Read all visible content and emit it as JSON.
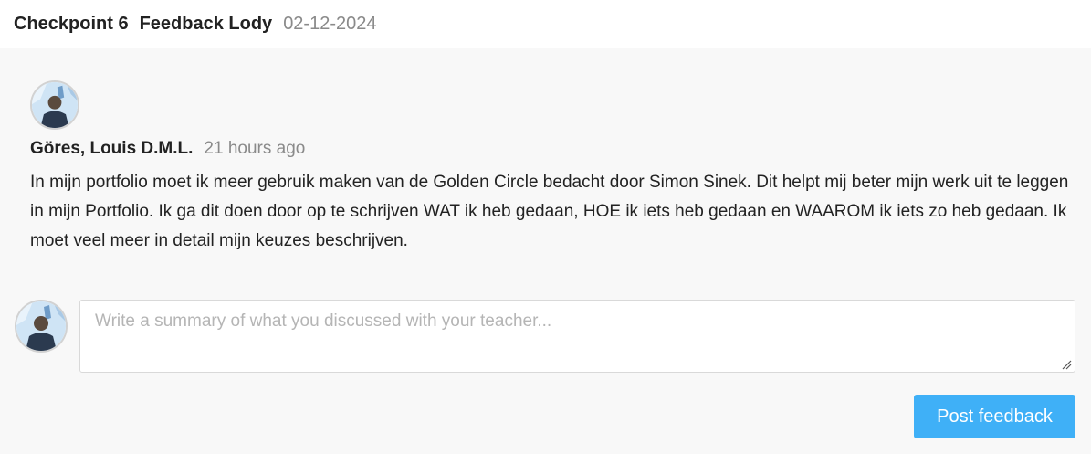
{
  "header": {
    "checkpoint": "Checkpoint 6",
    "title": "Feedback Lody",
    "date": "02-12-2024"
  },
  "comment": {
    "author": "Göres, Louis D.M.L.",
    "time": "21 hours ago",
    "body": "In mijn portfolio moet ik meer gebruik maken van de Golden Circle bedacht door Simon Sinek. Dit helpt mij beter mijn werk uit te leggen in mijn Portfolio. Ik ga dit doen door op te schrijven WAT ik heb gedaan, HOE ik iets heb gedaan en WAAROM ik iets zo heb gedaan. Ik moet veel meer in detail mijn keuzes beschrijven."
  },
  "composer": {
    "placeholder": "Write a summary of what you discussed with your teacher...",
    "value": "",
    "post_label": "Post feedback"
  },
  "colors": {
    "accent": "#3fb0f7",
    "panel_bg": "#f8f8f8",
    "muted_text": "#8a8a8a"
  }
}
